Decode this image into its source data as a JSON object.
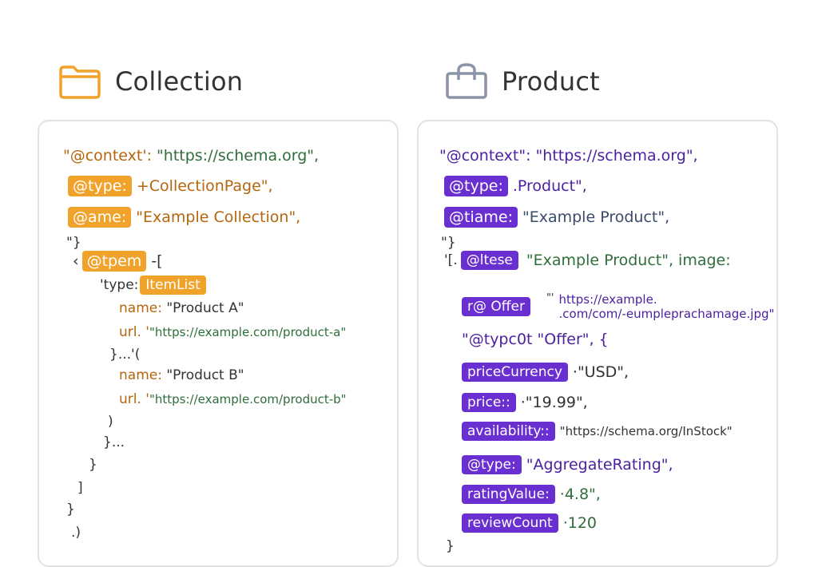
{
  "collection": {
    "title": "Collection",
    "icon": "folder-icon",
    "accent": "#f0a22a",
    "lines": {
      "context_key": "\"@context':",
      "context_val": "\"https://schema.org\",",
      "type_tag": "@type:",
      "type_val": "+CollectionPage\",",
      "name_tag": "@ame:",
      "name_val": "\"Example Collection\",",
      "brace1": "\"}",
      "item_pre": "‹",
      "item_tag": "@tpem",
      "item_post": "-[",
      "list_pre": "'type:",
      "list_tag": "ItemList",
      "a_name_key": "name:",
      "a_name_val": "\"Product A\"",
      "a_url_key": "url. '",
      "a_url_val": "\"https://example.com/product-a\"",
      "sep": "}...'(",
      "b_name_key": "name:",
      "b_name_val": "\"Product B\"",
      "b_url_key": "url. '",
      "b_url_val": "\"https://example.com/product-b\"",
      "close1": ")",
      "close2": "}...",
      "close3": "}",
      "close4": "]",
      "close5": "}",
      "close6": ".)"
    }
  },
  "product": {
    "title": "Product",
    "icon": "shopping-bag-icon",
    "accent": "#6a2fd0",
    "lines": {
      "context_key": "\"@context\":",
      "context_val": "\"https://schema.org\",",
      "type_tag": "@type:",
      "type_val": ".Product\",",
      "name_tag": "@tiame:",
      "name_val": "\"Example Product\",",
      "brace1": "\"}",
      "item_pre": "'[.",
      "item_tag": "@ltese",
      "item_val": "\"Example Product\", image:",
      "offer_tag": "r@ Offer",
      "offer_pre": "\"'",
      "offer_url1": "https://example.",
      "offer_url2": ".com/com/-eumpleprachamage.jpg\"",
      "offer_type": "\"@typc0t \"Offer\", {",
      "currency_tag": "priceCurrency",
      "currency_val": "·\"USD\",",
      "price_tag": "price::",
      "price_val": "·\"19.99\",",
      "avail_tag": "availability::",
      "avail_val": "\"https://schema.org/InStock\"",
      "rtype_tag": "@type:",
      "rtype_val": "\"AggregateRating\",",
      "rating_tag": "ratingValue:",
      "rating_val": "·4.8\",",
      "count_tag": "reviewCount",
      "count_val": "·120",
      "close1": "}"
    }
  }
}
